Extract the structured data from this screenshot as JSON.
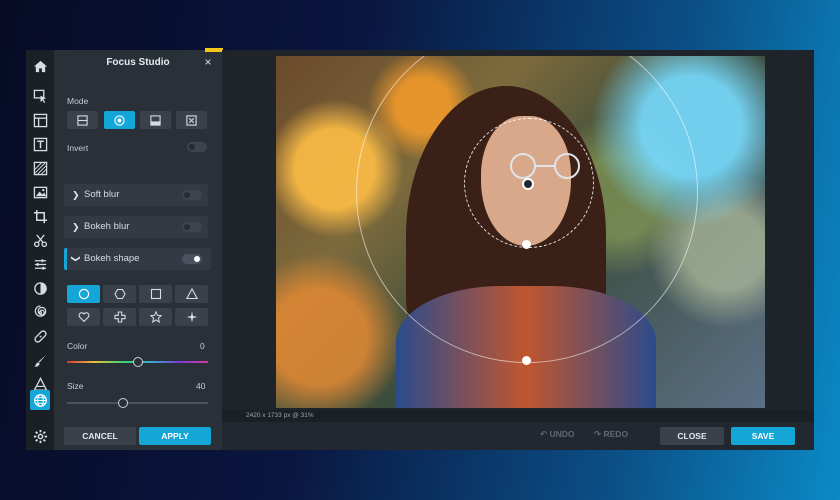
{
  "panel": {
    "title": "Focus Studio",
    "close_glyph": "×",
    "mode_label": "Mode",
    "invert_label": "Invert",
    "rows": {
      "soft_blur": "Soft blur",
      "bokeh_blur": "Bokeh blur",
      "bokeh_shape": "Bokeh shape"
    },
    "color_label": "Color",
    "color_value": "0",
    "size_label": "Size",
    "size_value": "40",
    "cancel_label": "CANCEL",
    "apply_label": "APPLY"
  },
  "mode_buttons": [
    "linear-mode-icon",
    "radial-mode-icon",
    "mirror-mode-icon",
    "none-mode-icon"
  ],
  "shapes": [
    "circle-shape-icon",
    "hexagon-shape-icon",
    "square-shape-icon",
    "triangle-shape-icon",
    "heart-shape-icon",
    "cross-shape-icon",
    "star-shape-icon",
    "sparkle-shape-icon"
  ],
  "toggles": {
    "invert": false,
    "soft_blur": false,
    "bokeh_blur": false,
    "bokeh_shape": true
  },
  "sliders": {
    "color_fraction": 0.5,
    "size_fraction": 0.4
  },
  "status": {
    "image_info": "2420 x 1733 px @ 31%"
  },
  "bottombar": {
    "undo_label": "UNDO",
    "redo_label": "REDO",
    "close_label": "CLOSE",
    "save_label": "SAVE"
  },
  "colors": {
    "accent": "#15a6d8",
    "yellow_tab": "#f5c518"
  }
}
